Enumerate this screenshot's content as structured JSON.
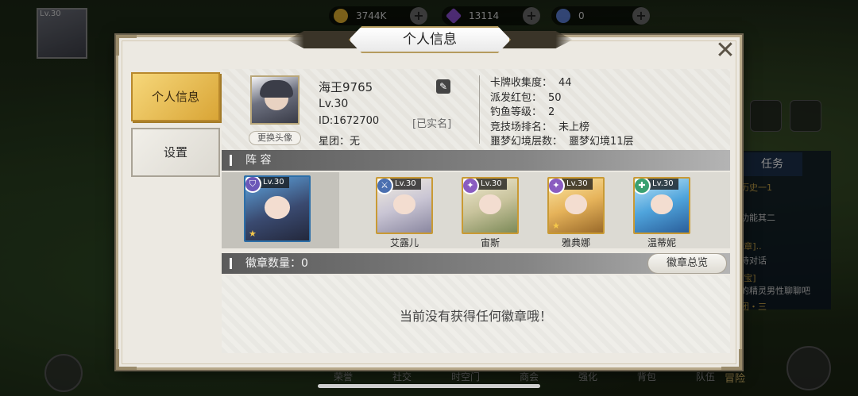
{
  "background": {
    "player_level": "Lv.30",
    "resources": [
      {
        "icon": "gold-coin-icon",
        "value": "3744K",
        "color": "#e0b030"
      },
      {
        "icon": "crystal-icon",
        "value": "13114",
        "color": "#8a4fd0"
      },
      {
        "icon": "gem-icon",
        "value": "0",
        "color": "#5c7fd4"
      }
    ],
    "task_button": "任务",
    "task_lines": [
      "历史一1",
      "功能其二",
      "[章]..",
      "待对话",
      "[宝]",
      "的精灵男性聊聊吧",
      "团・三"
    ],
    "bottom_nav": [
      "荣誉",
      "社交",
      "时空门",
      "商会",
      "强化",
      "背包",
      "队伍"
    ],
    "adventure_label": "冒险"
  },
  "dialog": {
    "title": "个人信息",
    "close_icon": "close-icon",
    "tabs": [
      {
        "label": "个人信息",
        "active": true
      },
      {
        "label": "设置",
        "active": false
      }
    ],
    "profile": {
      "name": "海王9765",
      "level": "Lv.30",
      "id": "ID:1672700",
      "verified": "[已实名]",
      "guild": "星团：无",
      "change_avatar": "更换头像"
    },
    "stats": [
      {
        "label": "卡牌收集度：",
        "value": "44"
      },
      {
        "label": "派发红包：",
        "value": "50"
      },
      {
        "label": "钓鱼等级：",
        "value": "2"
      },
      {
        "label": "竞技场排名：",
        "value": "未上榜"
      },
      {
        "label": "噩梦幻境层数：",
        "value": "噩梦幻境11层"
      }
    ],
    "team_section": "阵 容",
    "team": [
      {
        "name": "",
        "level": "Lv.30",
        "class_icon": "shield-icon",
        "class_color": "#6c58b8",
        "leader": true
      },
      {
        "name": "艾露儿",
        "level": "Lv.30",
        "class_icon": "swords-icon",
        "class_color": "#4a6fb0",
        "leader": false
      },
      {
        "name": "宙斯",
        "level": "Lv.30",
        "class_icon": "magic-icon",
        "class_color": "#8a5cc0",
        "leader": false
      },
      {
        "name": "雅典娜",
        "level": "Lv.30",
        "class_icon": "magic-icon",
        "class_color": "#8a5cc0",
        "leader": false
      },
      {
        "name": "温蒂妮",
        "level": "Lv.30",
        "class_icon": "heal-icon",
        "class_color": "#3aa070",
        "leader": false
      }
    ],
    "badge_section": "徽章数量：0",
    "badge_overview": "徽章总览",
    "badge_empty": "当前没有获得任何徽章哦！"
  }
}
